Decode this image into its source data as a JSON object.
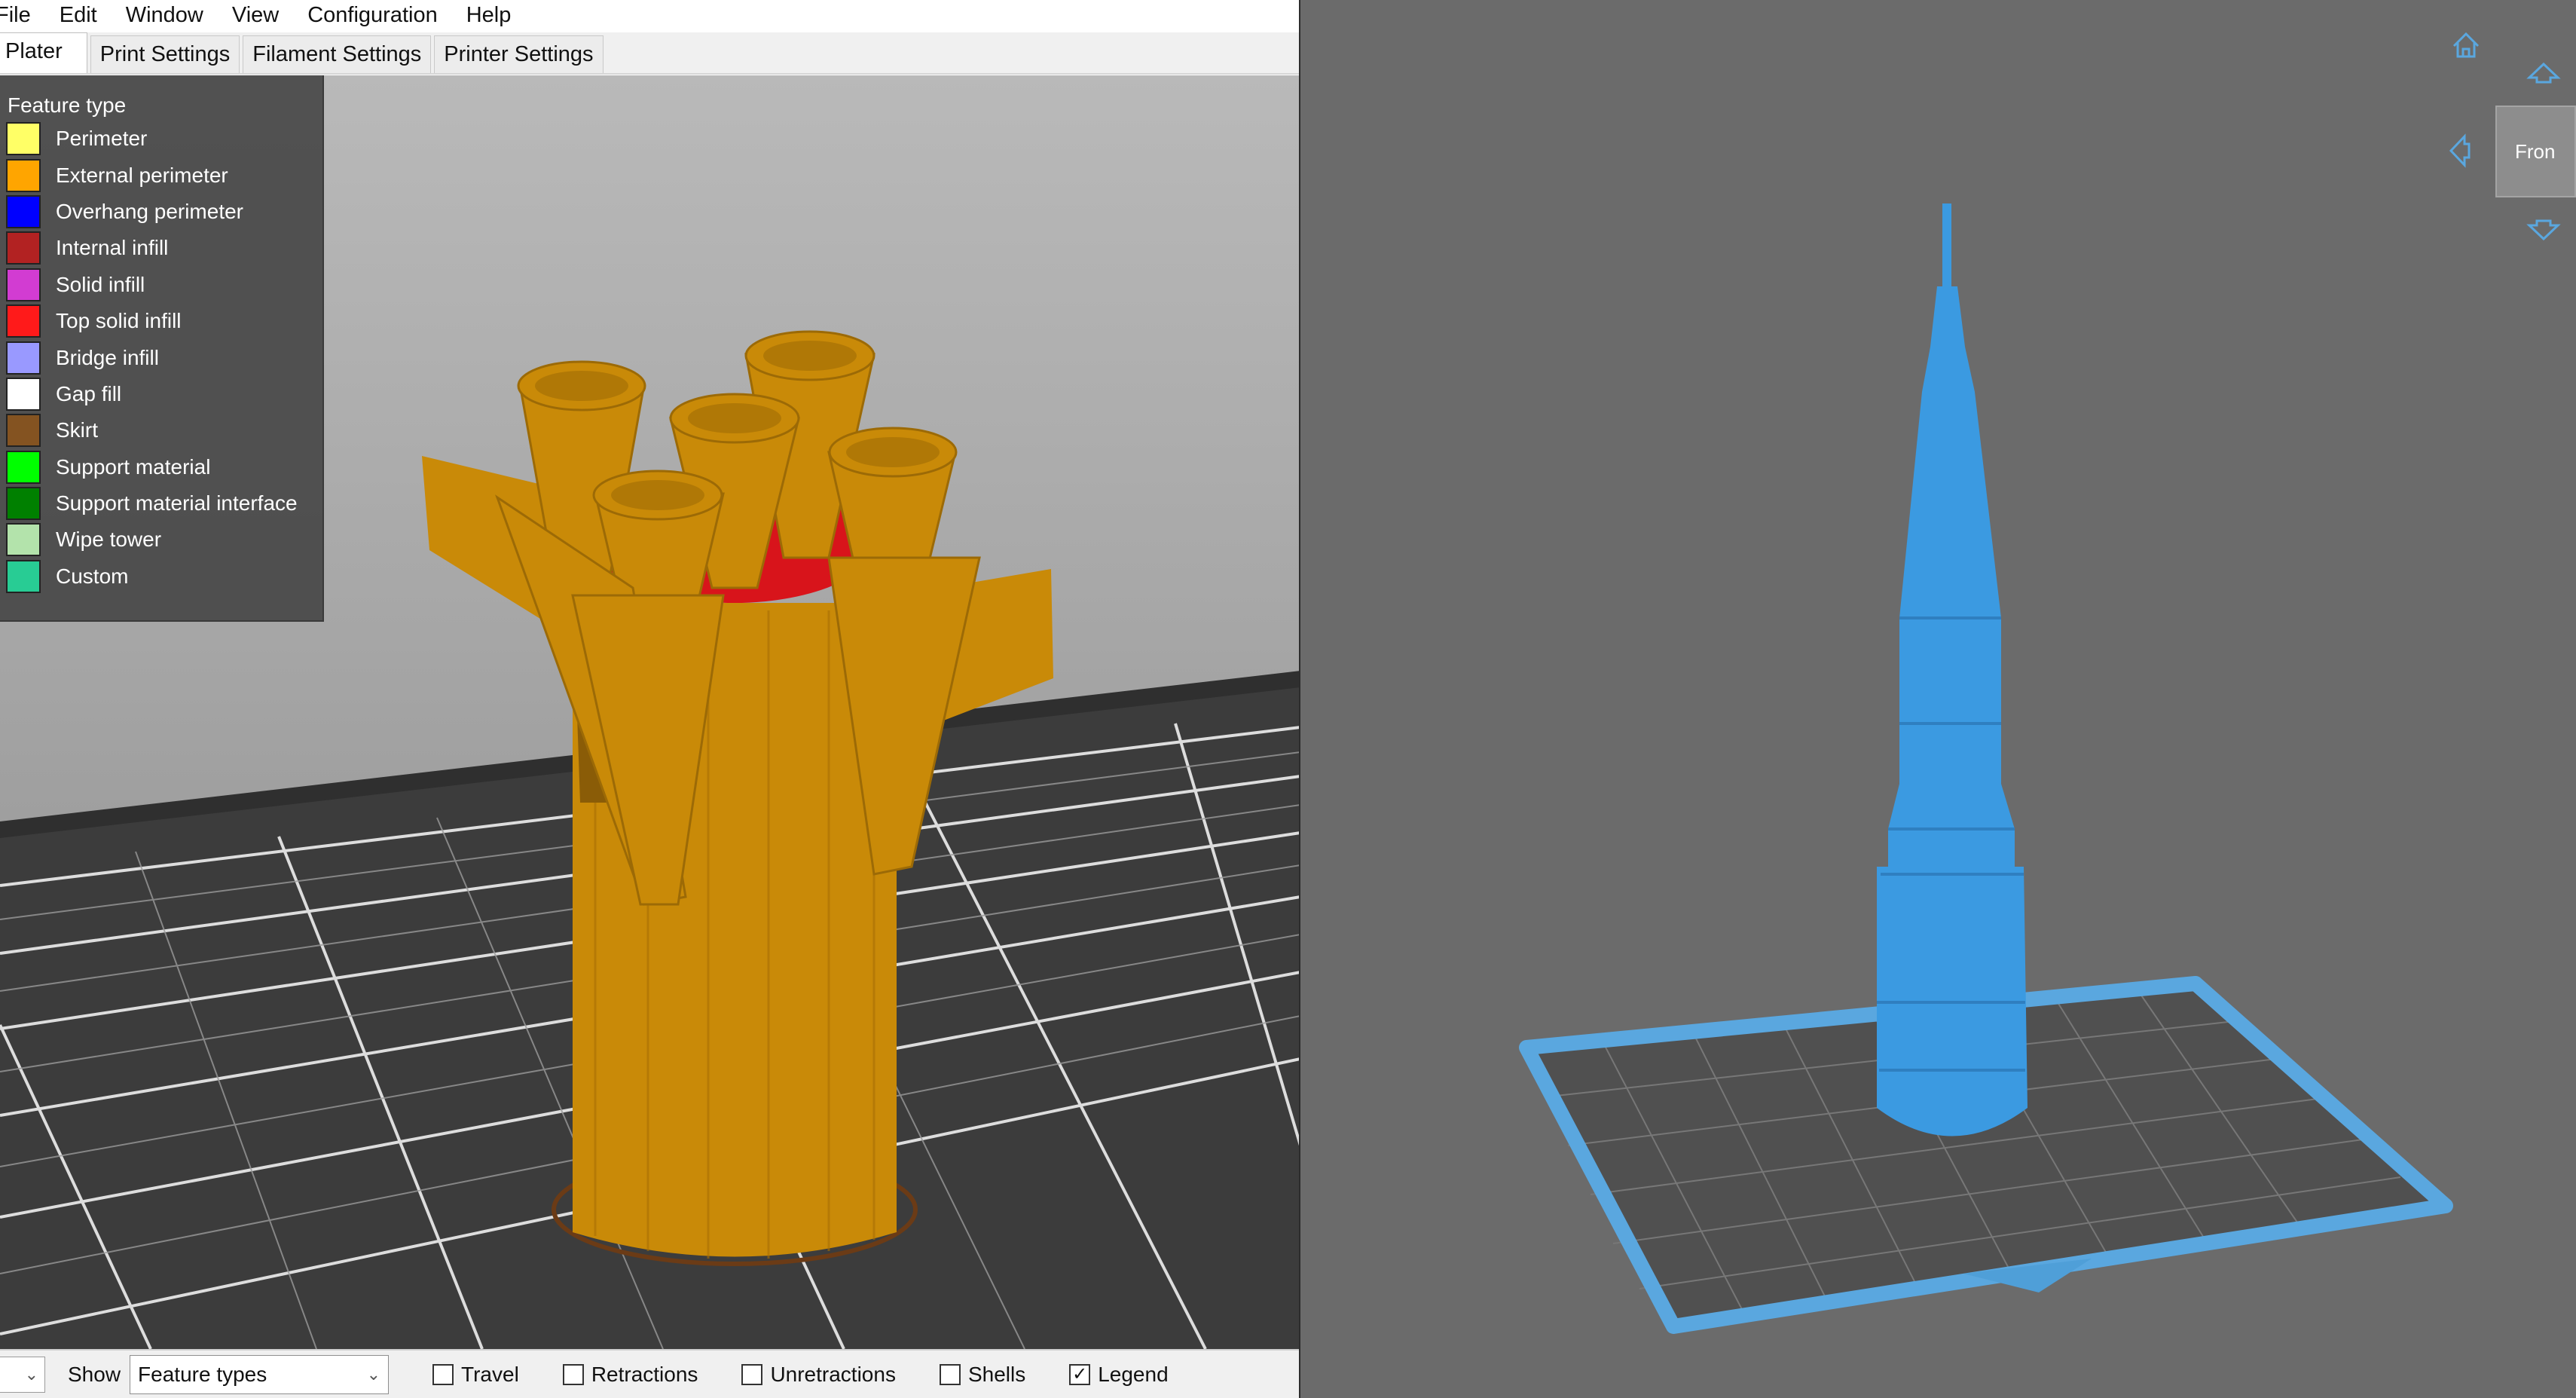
{
  "menubar": {
    "items": [
      "File",
      "Edit",
      "Window",
      "View",
      "Configuration",
      "Help"
    ]
  },
  "tabs": {
    "items": [
      "Plater",
      "Print Settings",
      "Filament Settings",
      "Printer Settings"
    ],
    "active": "Plater"
  },
  "legend": {
    "title": "Feature type",
    "items": [
      {
        "label": "Perimeter",
        "color": "#ffff66"
      },
      {
        "label": "External perimeter",
        "color": "#ffa500"
      },
      {
        "label": "Overhang perimeter",
        "color": "#0000ff"
      },
      {
        "label": "Internal infill",
        "color": "#b22222"
      },
      {
        "label": "Solid infill",
        "color": "#d23cd2"
      },
      {
        "label": "Top solid infill",
        "color": "#ff1a1a"
      },
      {
        "label": "Bridge infill",
        "color": "#9999ff"
      },
      {
        "label": "Gap fill",
        "color": "#ffffff"
      },
      {
        "label": "Skirt",
        "color": "#845321"
      },
      {
        "label": "Support material",
        "color": "#00ff00"
      },
      {
        "label": "Support material interface",
        "color": "#008000"
      },
      {
        "label": "Wipe tower",
        "color": "#b3e3ab"
      },
      {
        "label": "Custom",
        "color": "#28cc94"
      }
    ]
  },
  "bottombar": {
    "show_label": "Show",
    "show_value": "Feature types",
    "checkboxes": [
      {
        "label": "Travel",
        "checked": false
      },
      {
        "label": "Retractions",
        "checked": false
      },
      {
        "label": "Unretractions",
        "checked": false
      },
      {
        "label": "Shells",
        "checked": false
      },
      {
        "label": "Legend",
        "checked": true
      }
    ],
    "check_mark": "✓"
  },
  "viewer": {
    "view_cube_label": "Fron",
    "model_color": "#3b9ae1",
    "plate_border_color": "#5aa7df"
  },
  "colors": {
    "print_orange": "#c98a08",
    "top_infill_red": "#d8141b"
  }
}
